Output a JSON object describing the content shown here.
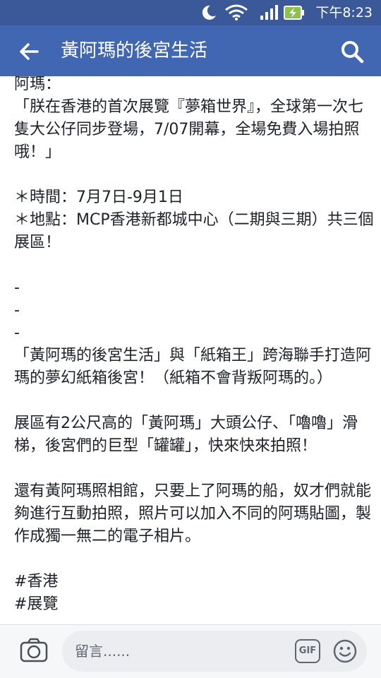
{
  "status_bar": {
    "time": "下午8:23",
    "icons": [
      "moon-icon",
      "wifi-icon",
      "signal-icon",
      "battery-charging-icon"
    ],
    "background": "#3b5998"
  },
  "app_bar": {
    "title": "黃阿瑪的後宮生活",
    "back_icon": "arrow-left-icon",
    "search_icon": "search-icon",
    "background": "#4267b2"
  },
  "post": {
    "text": "阿瑪：\n「朕在香港的首次展覽『夢箱世界』，全球第一次七隻大公仔同步登場，7/07開幕，全場免費入場拍照哦！」\n\n＊時間：7月7日-9月1日\n＊地點：MCP香港新都城中心（二期與三期）共三個展區！\n\n-\n-\n-\n「黃阿瑪的後宮生活」與「紙箱王」跨海聯手打造阿瑪的夢幻紙箱後宮！（紙箱不會背叛阿瑪的。）\n\n展區有2公尺高的「黃阿瑪」大頭公仔、「嚕嚕」滑梯，後宮們的巨型「罐罐」，快來快來拍照！\n\n還有黃阿瑪照相館，只要上了阿瑪的船，奴才們就能夠進行互動拍照，照片可以加入不同的阿瑪貼圖，製作成獨一無二的電子相片。\n\n#香港\n#展覽"
  },
  "comment_bar": {
    "placeholder": "留言......",
    "gif_label": "GIF",
    "camera_icon": "camera-icon",
    "emoji_icon": "smiley-icon"
  }
}
